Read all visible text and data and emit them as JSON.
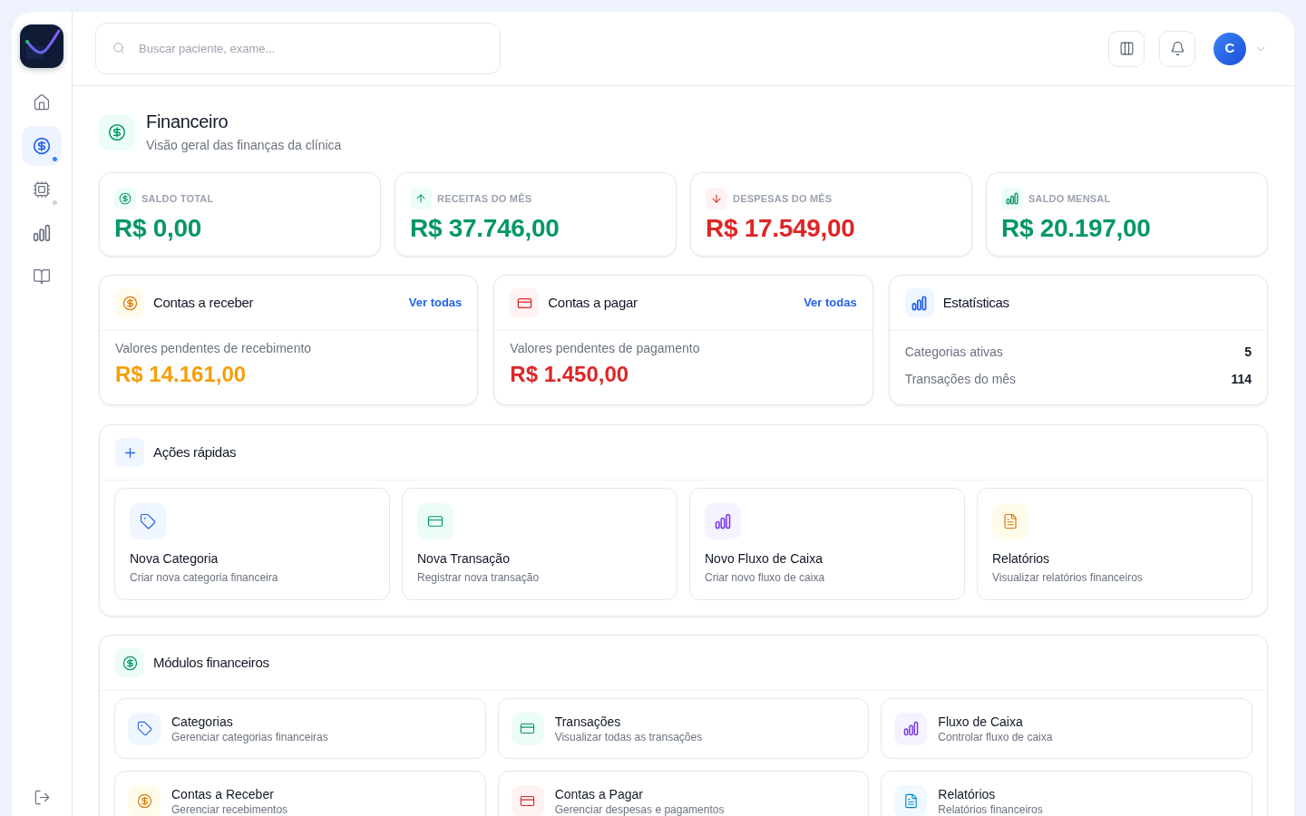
{
  "sidebar": {
    "items": [
      {
        "selected": false,
        "has_submenu": false
      },
      {
        "selected": true,
        "has_submenu": true
      },
      {
        "selected": false,
        "has_submenu": true
      },
      {
        "selected": false,
        "has_submenu": false
      },
      {
        "selected": false,
        "has_submenu": false
      }
    ]
  },
  "header": {
    "search": {
      "placeholder": "Buscar paciente, exame..."
    },
    "user": {
      "initial": "C"
    }
  },
  "page": {
    "title": "Financeiro",
    "subtitle": "Visão geral das finanças da clínica"
  },
  "stat_cards": [
    {
      "kind": "balance",
      "label": "SALDO TOTAL",
      "value": "R$ 0,00"
    },
    {
      "kind": "income",
      "label": "RECEITAS DO MÊS",
      "value": "R$ 37.746,00"
    },
    {
      "kind": "expense",
      "label": "DESPESAS DO MÊS",
      "value": "R$ 17.549,00"
    },
    {
      "kind": "monthly",
      "label": "SALDO MENSAL",
      "value": "R$ 20.197,00"
    }
  ],
  "account_cards": [
    {
      "kind": "receivable",
      "title": "Contas a receber",
      "link": "Ver todas",
      "caption": "Valores pendentes de recebimento",
      "amount": "R$ 14.161,00"
    },
    {
      "kind": "payable",
      "title": "Contas a pagar",
      "link": "Ver todas",
      "caption": "Valores pendentes de pagamento",
      "amount": "R$ 1.450,00"
    }
  ],
  "statistics": {
    "title": "Estatísticas",
    "rows": [
      {
        "label": "Categorias ativas",
        "value": "5"
      },
      {
        "label": "Transações do mês",
        "value": "114"
      }
    ]
  },
  "quick_actions": {
    "title": "Ações rápidas",
    "items": [
      {
        "kind": "category",
        "title": "Nova Categoria",
        "description": "Criar nova categoria financeira"
      },
      {
        "kind": "transaction",
        "title": "Nova Transação",
        "description": "Registrar nova transação"
      },
      {
        "kind": "cashflow",
        "title": "Novo Fluxo de Caixa",
        "description": "Criar novo fluxo de caixa"
      },
      {
        "kind": "report",
        "title": "Relatórios",
        "description": "Visualizar relatórios financeiros"
      }
    ]
  },
  "financial_modules": {
    "title": "Módulos financeiros",
    "items": [
      {
        "kind": "category",
        "title": "Categorias",
        "description": "Gerenciar categorias financeiras"
      },
      {
        "kind": "transaction",
        "title": "Transações",
        "description": "Visualizar todas as transações"
      },
      {
        "kind": "cashflow",
        "title": "Fluxo de Caixa",
        "description": "Controlar fluxo de caixa"
      },
      {
        "kind": "receivable",
        "title": "Contas a Receber",
        "description": "Gerenciar recebimentos"
      },
      {
        "kind": "payable",
        "title": "Contas a Pagar",
        "description": "Gerenciar despesas e pagamentos"
      },
      {
        "kind": "report",
        "title": "Relatórios",
        "description": "Relatórios financeiros"
      }
    ]
  }
}
